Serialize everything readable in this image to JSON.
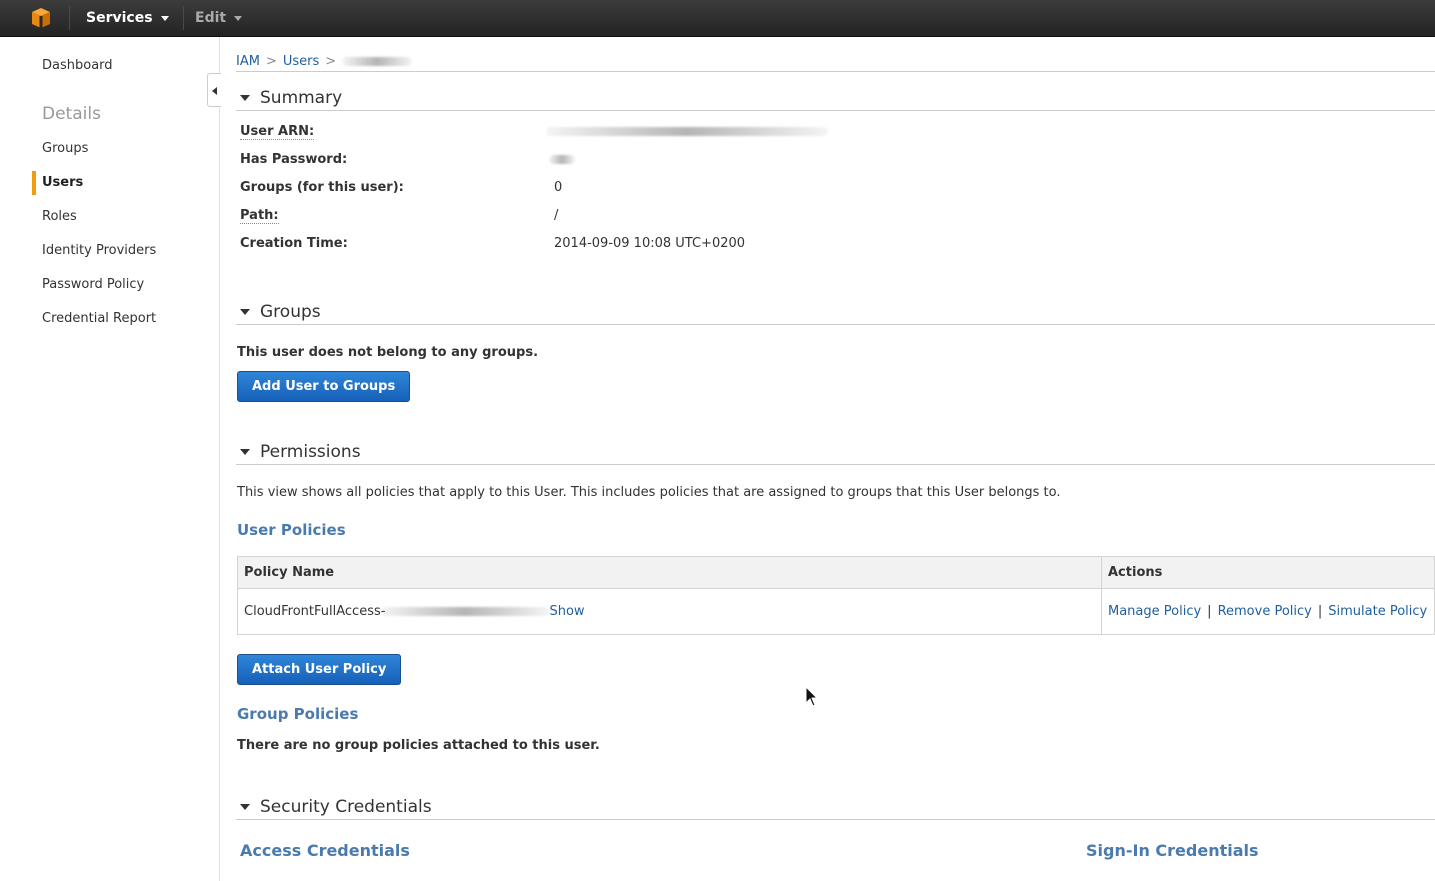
{
  "topbar": {
    "services_label": "Services",
    "edit_label": "Edit"
  },
  "sidebar": {
    "dashboard": "Dashboard",
    "details_heading": "Details",
    "items": [
      "Groups",
      "Users",
      "Roles",
      "Identity Providers",
      "Password Policy",
      "Credential Report"
    ],
    "active_item": "Users"
  },
  "breadcrumb": {
    "iam": "IAM",
    "users": "Users",
    "sep": ">"
  },
  "summary": {
    "title": "Summary",
    "rows": [
      {
        "label": "User ARN:",
        "value": ""
      },
      {
        "label": "Has Password:",
        "value": ""
      },
      {
        "label": "Groups (for this user):",
        "value": "0"
      },
      {
        "label": "Path:",
        "value": "/"
      },
      {
        "label": "Creation Time:",
        "value": "2014-09-09 10:08 UTC+0200"
      }
    ]
  },
  "groups": {
    "title": "Groups",
    "message": "This user does not belong to any groups.",
    "add_button": "Add User to Groups"
  },
  "permissions": {
    "title": "Permissions",
    "description": "This view shows all policies that apply to this User. This includes policies that are assigned to groups that this User belongs to.",
    "user_policies_heading": "User Policies",
    "table": {
      "col_policy": "Policy Name",
      "col_actions": "Actions",
      "rows": [
        {
          "policy_name": "CloudFrontFullAccess-",
          "show_link": "Show",
          "actions": [
            "Manage Policy",
            "Remove Policy",
            "Simulate Policy"
          ]
        }
      ]
    },
    "attach_button": "Attach User Policy",
    "group_policies_heading": "Group Policies",
    "group_policies_message": "There are no group policies attached to this user."
  },
  "security": {
    "title": "Security Credentials",
    "access_heading": "Access Credentials",
    "signin_heading": "Sign-In Credentials"
  },
  "colors": {
    "topbar": "#2b2b2b",
    "accent_orange": "#f39c12",
    "link_blue": "#1f5f9f",
    "subhead_blue": "#4a7aae",
    "button_blue": "#1b6ac9"
  }
}
